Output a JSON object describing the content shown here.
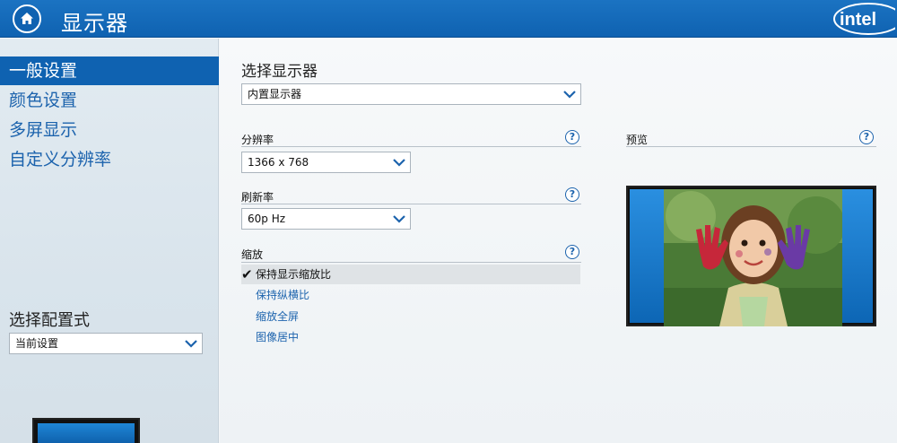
{
  "header": {
    "title": "显示器",
    "logo_text": "intel"
  },
  "sidebar": {
    "items": [
      {
        "label": "一般设置",
        "active": true
      },
      {
        "label": "颜色设置",
        "active": false
      },
      {
        "label": "多屏显示",
        "active": false
      },
      {
        "label": "自定义分辨率",
        "active": false
      }
    ],
    "profile_label": "选择配置式",
    "profile_value": "当前设置"
  },
  "main": {
    "title": "选择显示器",
    "display_value": "内置显示器",
    "resolution": {
      "label": "分辨率",
      "value": "1366 x 768"
    },
    "refresh": {
      "label": "刷新率",
      "value": "60p Hz"
    },
    "scaling": {
      "label": "缩放",
      "options": [
        {
          "label": "保持显示缩放比",
          "selected": true
        },
        {
          "label": "保持纵横比",
          "selected": false
        },
        {
          "label": "缩放全屏",
          "selected": false
        },
        {
          "label": "图像居中",
          "selected": false
        }
      ]
    },
    "preview": {
      "label": "预览"
    },
    "help_glyph": "?"
  },
  "colors": {
    "accent": "#0f62b1",
    "link": "#1c63ad"
  }
}
